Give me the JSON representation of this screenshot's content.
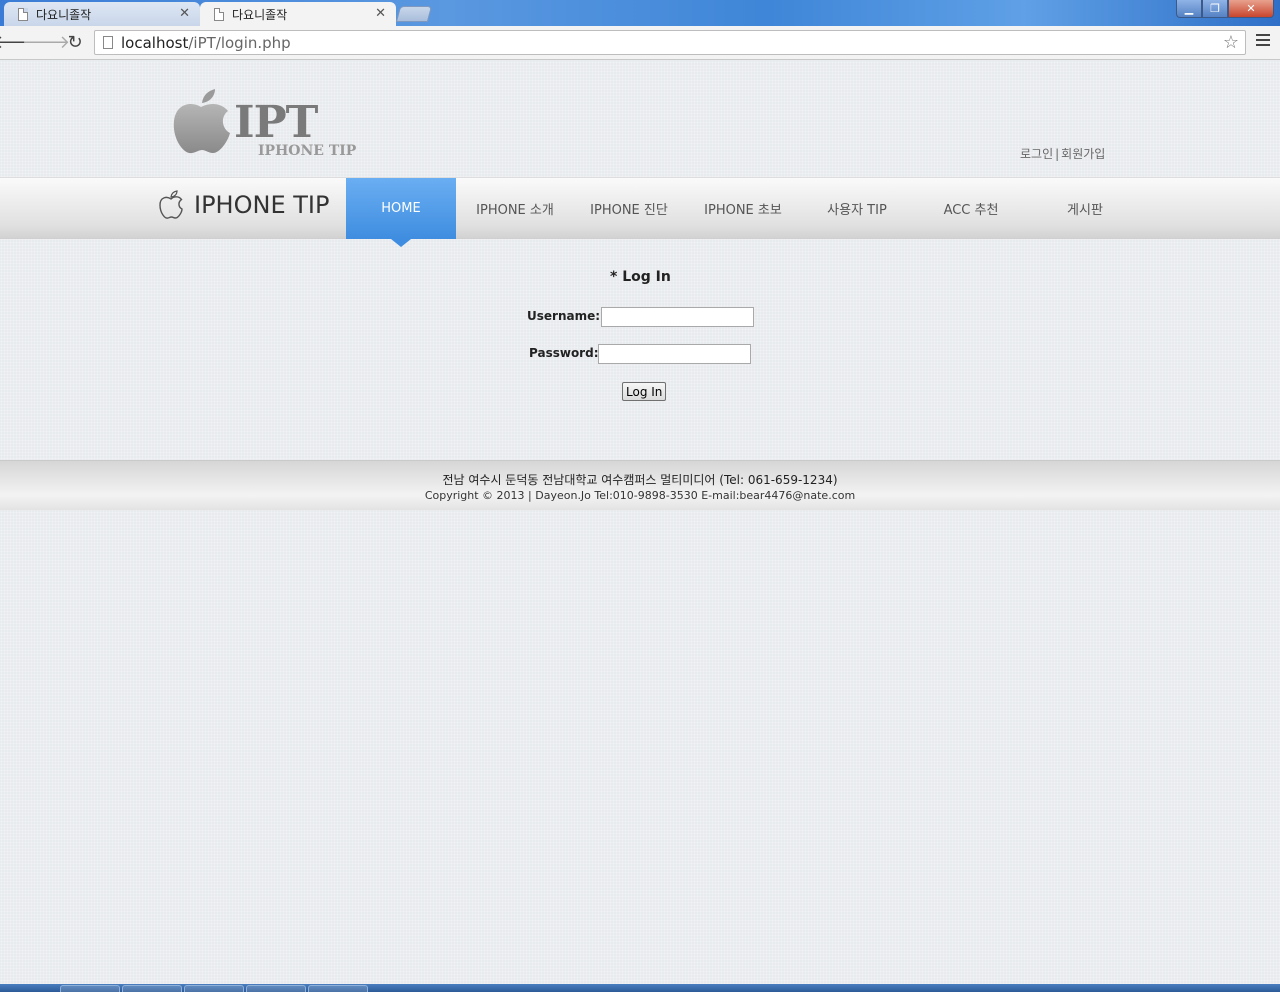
{
  "browser": {
    "tabs": [
      {
        "label": "다요니졸작",
        "active": false
      },
      {
        "label": "다요니졸작",
        "active": true
      }
    ],
    "url_host": "localhost",
    "url_path": "/iPT/login.php"
  },
  "header": {
    "logo_big": "IPT",
    "logo_small": "IPHONE TIP",
    "login_link": "로그인",
    "separator": "|",
    "signup_link": "회원가입"
  },
  "nav": {
    "brand": "IPHONE TIP",
    "items": [
      {
        "label": "HOME",
        "active": true
      },
      {
        "label": "IPHONE 소개"
      },
      {
        "label": "IPHONE 진단"
      },
      {
        "label": "IPHONE 초보"
      },
      {
        "label": "사용자 TIP"
      },
      {
        "label": "ACC 추천"
      },
      {
        "label": "게시판"
      }
    ]
  },
  "login": {
    "title": "* Log In",
    "username_label": "Username:",
    "username_value": "",
    "password_label": "Password:",
    "password_value": "",
    "button_label": "Log In"
  },
  "footer": {
    "line1": "전남 여수시 둔덕동 전남대학교 여수캠퍼스 멀티미디어 (Tel: 061-659-1234)",
    "line2": "Copyright © 2013 | Dayeon.Jo  Tel:010-9898-3530 E-mail:bear4476@nate.com"
  },
  "colors": {
    "nav_active": "#4a94e4",
    "page_bg": "#e8ebee"
  }
}
